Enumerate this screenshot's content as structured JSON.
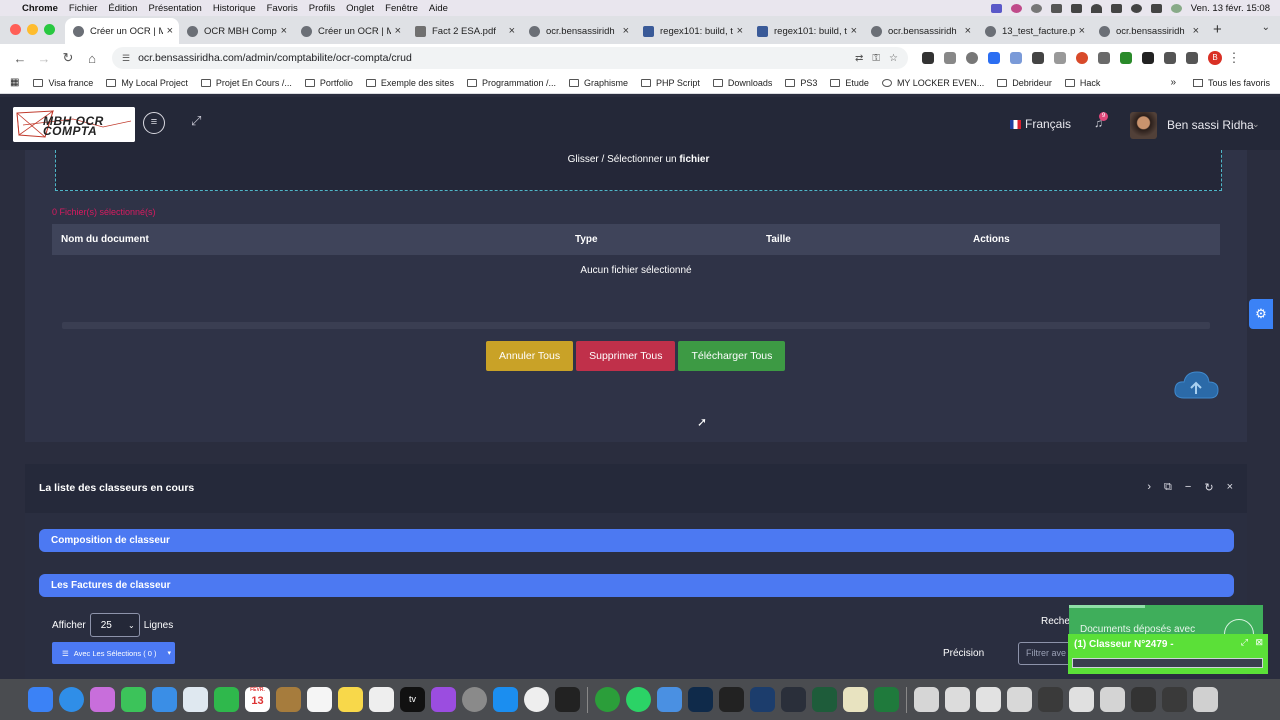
{
  "menubar": {
    "app": "Chrome",
    "items": [
      "Fichier",
      "Édition",
      "Présentation",
      "Historique",
      "Favoris",
      "Profils",
      "Onglet",
      "Fenêtre",
      "Aide"
    ],
    "clock": "Ven. 13 févr.  15:08"
  },
  "tabs": [
    {
      "label": "Créer un OCR | M",
      "active": true
    },
    {
      "label": "OCR MBH Compt",
      "active": false
    },
    {
      "label": "Créer un OCR | M",
      "active": false
    },
    {
      "label": "Fact 2 ESA.pdf",
      "active": false
    },
    {
      "label": "ocr.bensassiridh",
      "active": false
    },
    {
      "label": "regex101: build, t",
      "active": false
    },
    {
      "label": "regex101: build, t",
      "active": false
    },
    {
      "label": "ocr.bensassiridh",
      "active": false
    },
    {
      "label": "13_test_facture.p",
      "active": false
    },
    {
      "label": "ocr.bensassiridh",
      "active": false
    }
  ],
  "address": {
    "url": "ocr.bensassiridha.com/admin/comptabilite/ocr-compta/crud",
    "profile_letter": "B"
  },
  "bookmarks": [
    "Visa france",
    "My Local Project",
    "Projet En Cours /...",
    "Portfolio",
    "Exemple des sites",
    "Programmation /...",
    "Graphisme",
    "PHP Script",
    "Downloads",
    "PS3",
    "Etude",
    "MY LOCKER EVEN...",
    "Debrideur",
    "Hack"
  ],
  "bookmarks_all": "Tous les favoris",
  "header": {
    "logo_text": "MBH OCR COMPTA",
    "language": "Français",
    "notif_count": "9",
    "user_name": "Ben sassi Ridha"
  },
  "upload": {
    "drop_text": "Glisser / Sélectionner un ",
    "drop_bold": "fichier",
    "selected_count": "0 Fichier(s) sélectionné(s)",
    "columns": {
      "name": "Nom du document",
      "type": "Type",
      "size": "Taille",
      "actions": "Actions"
    },
    "empty": "Aucun fichier sélectionné",
    "cancel_all": "Annuler Tous",
    "delete_all": "Supprimer Tous",
    "upload_all": "Télécharger Tous"
  },
  "classeurs": {
    "title": "La liste des classeurs en cours",
    "composition": "Composition de classeur",
    "factures": "Les Factures de classeur",
    "show_label": "Afficher",
    "show_value": "25",
    "rows_label": "Lignes",
    "with_selection": "Avec Les Sélections ( 0 )",
    "search_label": "Recher",
    "precision_label": "Précision",
    "filter_placeholder": "Filtrer ave"
  },
  "toasts": {
    "uploaded": "Documents déposés avec",
    "classeur": "(1) Classeur N°2479 -"
  },
  "colors": {
    "accent_blue": "#4c79f2",
    "cancel_yellow": "#c9a227",
    "delete_red": "#c0304a",
    "upload_green": "#3d9a44",
    "selection_pink": "#d81b60"
  }
}
